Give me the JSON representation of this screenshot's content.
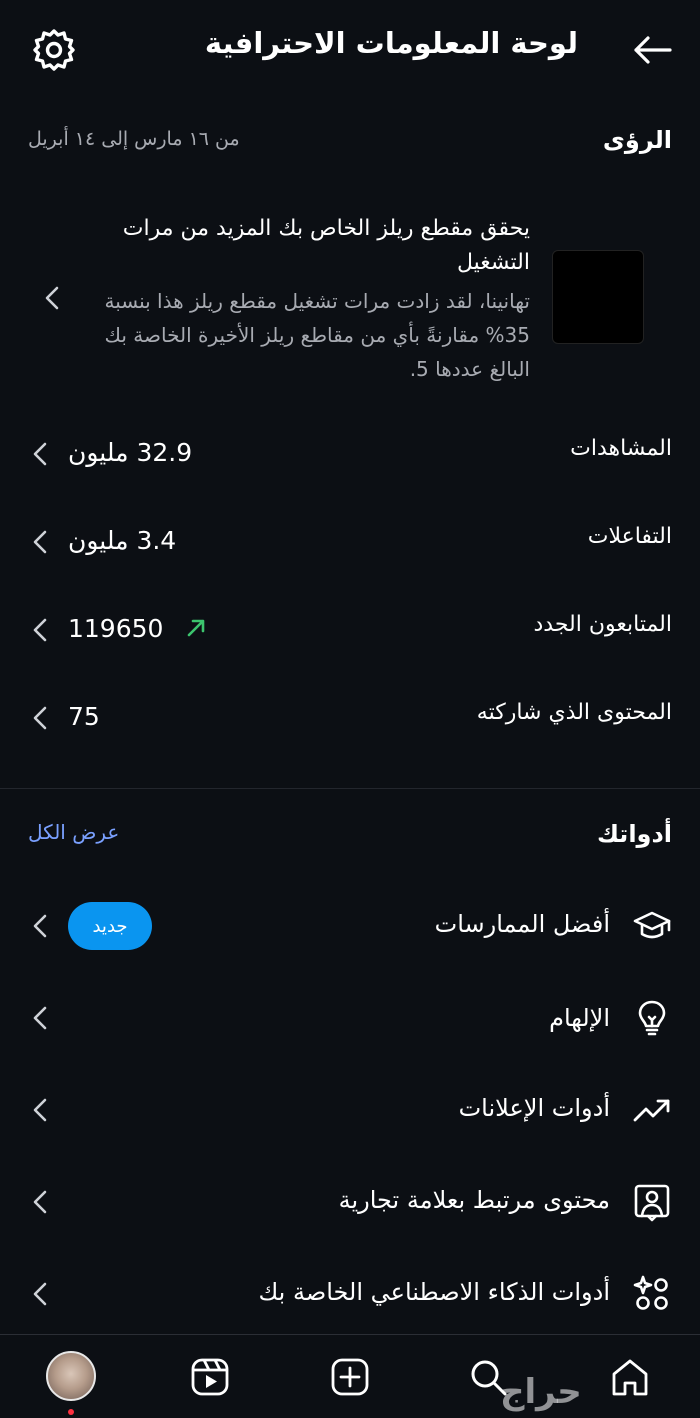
{
  "header": {
    "title": "لوحة المعلومات الاحترافية",
    "back_icon": "arrow-left-icon",
    "settings_icon": "gear-icon"
  },
  "insights": {
    "title": "الرؤى",
    "date_range": "من ١٦ مارس إلى ١٤ أبريل",
    "card": {
      "title": "يحقق مقطع ريلز الخاص بك المزيد من مرات التشغيل",
      "description": "تهانينا، لقد زادت مرات تشغيل مقطع ريلز هذا بنسبة 35% مقارنةً بأي من مقاطع ريلز الأخيرة الخاصة بك البالغ عددها 5."
    },
    "metrics": [
      {
        "label": "المشاهدات",
        "value": "32.9 مليون"
      },
      {
        "label": "التفاعلات",
        "value": "3.4 مليون"
      },
      {
        "label": "المتابعون الجدد",
        "value": "119650",
        "trend": "up"
      },
      {
        "label": "المحتوى الذي شاركته",
        "value": "75"
      }
    ]
  },
  "tools": {
    "title": "أدواتك",
    "see_all": "عرض الكل",
    "items": [
      {
        "label": "أفضل الممارسات",
        "icon": "graduation-cap-icon",
        "badge": "جديد"
      },
      {
        "label": "الإلهام",
        "icon": "lightbulb-icon"
      },
      {
        "label": "أدوات الإعلانات",
        "icon": "trending-up-icon"
      },
      {
        "label": "محتوى مرتبط بعلامة تجارية",
        "icon": "branded-content-icon"
      },
      {
        "label": "أدوات الذكاء الاصطناعي الخاصة بك",
        "icon": "ai-tools-icon"
      }
    ]
  },
  "bottom_nav": {
    "items": [
      "home-icon",
      "search-icon",
      "create-icon",
      "reels-icon",
      "profile-avatar"
    ]
  },
  "watermark": "حراج",
  "colors": {
    "background": "#0c0f14",
    "accent_blue": "#0a95f0",
    "link_blue": "#7aa0ff",
    "trend_green": "#3cc46e",
    "secondary_text": "#a8abb2"
  }
}
